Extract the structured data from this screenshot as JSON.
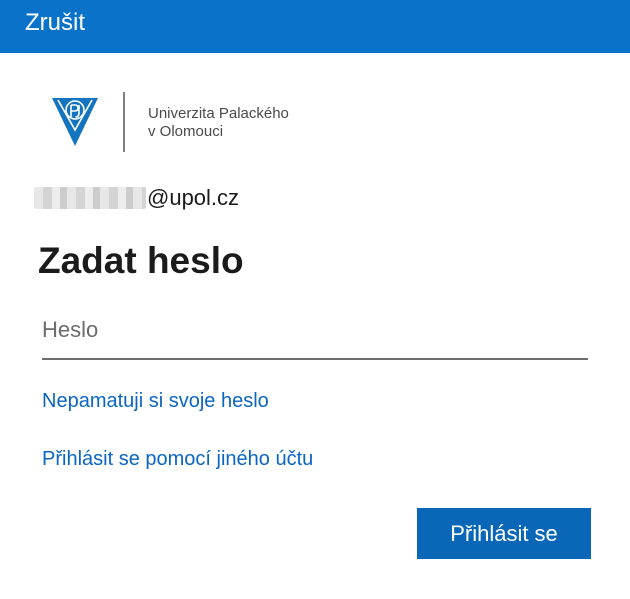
{
  "header": {
    "cancel_label": "Zrušit"
  },
  "branding": {
    "logo_icon": "upol-shield-icon",
    "name_line1": "Univerzita Palackého",
    "name_line2": "v Olomouci",
    "shield_color": "#1474be"
  },
  "account": {
    "email_domain": "@upol.cz"
  },
  "form": {
    "title": "Zadat heslo",
    "password_placeholder": "Heslo",
    "password_value": "",
    "forgot_password_link": "Nepamatuji si svoje heslo",
    "other_account_link": "Přihlásit se pomocí jiného účtu",
    "submit_label": "Přihlásit se"
  },
  "colors": {
    "accent": "#0a72c9",
    "link": "#0a66c2",
    "button": "#0a67b8"
  }
}
